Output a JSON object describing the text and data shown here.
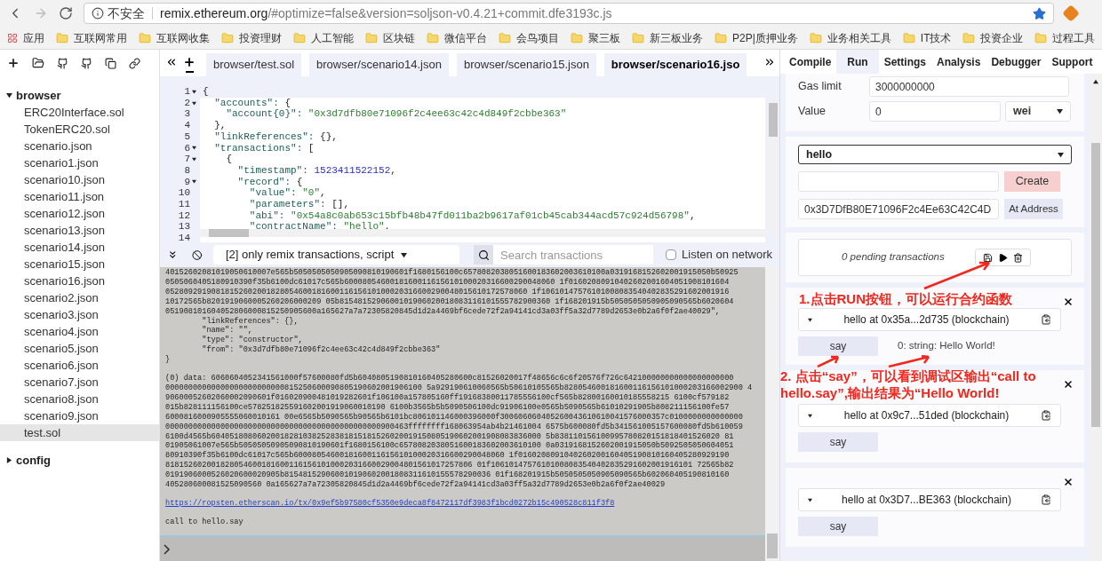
{
  "browser": {
    "security": "不安全",
    "url_host": "remix.ethereum.org",
    "url_rest": "/#optimize=false&version=soljson-v0.4.21+commit.dfe3193c.js"
  },
  "bookmarks": [
    {
      "label": "应用",
      "kind": "apps"
    },
    {
      "label": "互联网常用",
      "kind": "folder"
    },
    {
      "label": "互联网收集",
      "kind": "folder"
    },
    {
      "label": "投资理财",
      "kind": "folder"
    },
    {
      "label": "人工智能",
      "kind": "folder"
    },
    {
      "label": "区块链",
      "kind": "folder"
    },
    {
      "label": "微信平台",
      "kind": "folder"
    },
    {
      "label": "会鸟项目",
      "kind": "folder"
    },
    {
      "label": "聚三板",
      "kind": "folder"
    },
    {
      "label": "新三板业务",
      "kind": "folder"
    },
    {
      "label": "P2P|质押业务",
      "kind": "folder"
    },
    {
      "label": "业务相关工具",
      "kind": "folder"
    },
    {
      "label": "IT技术",
      "kind": "folder"
    },
    {
      "label": "投资企业",
      "kind": "folder"
    },
    {
      "label": "过程工具",
      "kind": "folder"
    }
  ],
  "file_explorer": {
    "folders": [
      {
        "name": "browser",
        "expanded": true,
        "children": [
          {
            "name": "ERC20Interface.sol",
            "selected": false
          },
          {
            "name": "TokenERC20.sol",
            "selected": false
          },
          {
            "name": "scenario.json",
            "selected": false
          },
          {
            "name": "scenario1.json",
            "selected": false
          },
          {
            "name": "scenario10.json",
            "selected": false
          },
          {
            "name": "scenario11.json",
            "selected": false
          },
          {
            "name": "scenario12.json",
            "selected": false
          },
          {
            "name": "scenario13.json",
            "selected": false
          },
          {
            "name": "scenario14.json",
            "selected": false
          },
          {
            "name": "scenario15.json",
            "selected": false
          },
          {
            "name": "scenario16.json",
            "selected": false
          },
          {
            "name": "scenario2.json",
            "selected": false
          },
          {
            "name": "scenario3.json",
            "selected": false
          },
          {
            "name": "scenario4.json",
            "selected": false
          },
          {
            "name": "scenario5.json",
            "selected": false
          },
          {
            "name": "scenario6.json",
            "selected": false
          },
          {
            "name": "scenario7.json",
            "selected": false
          },
          {
            "name": "scenario8.json",
            "selected": false
          },
          {
            "name": "scenario9.json",
            "selected": false
          },
          {
            "name": "test.sol",
            "selected": true
          }
        ]
      },
      {
        "name": "config",
        "expanded": false
      }
    ]
  },
  "editor": {
    "tabs": [
      {
        "label": "browser/test.sol",
        "selected": false
      },
      {
        "label": "browser/scenario14.json",
        "selected": false
      },
      {
        "label": "browser/scenario15.json",
        "selected": false
      },
      {
        "label": "browser/scenario16.jso",
        "selected": true
      }
    ],
    "lines": [
      {
        "number": "1",
        "fold": true,
        "text": "{"
      },
      {
        "number": "2",
        "fold": true,
        "text": "  \"accounts\": {"
      },
      {
        "number": "3",
        "fold": false,
        "text": "    \"account{0}\": \"0x3d7dfb80e71096f2c4ee63c42c4d849f2cbbe363\""
      },
      {
        "number": "4",
        "fold": false,
        "text": "  },"
      },
      {
        "number": "5",
        "fold": false,
        "text": "  \"linkReferences\": {},"
      },
      {
        "number": "6",
        "fold": true,
        "text": "  \"transactions\": ["
      },
      {
        "number": "7",
        "fold": true,
        "text": "    {"
      },
      {
        "number": "8",
        "fold": false,
        "text": "      \"timestamp\": 1523411522152,"
      },
      {
        "number": "9",
        "fold": true,
        "text": "      \"record\": {"
      },
      {
        "number": "10",
        "fold": false,
        "text": "        \"value\": \"0\","
      },
      {
        "number": "11",
        "fold": false,
        "text": "        \"parameters\": [],"
      },
      {
        "number": "12",
        "fold": false,
        "text": "        \"abi\": \"0x54a8c0ab653c15bfb48b47fd011ba2b9617af01cb45cab344acd57c924d56798\","
      },
      {
        "number": "13",
        "fold": false,
        "text": "        \"contractName\": \"hello\","
      },
      {
        "number": "14",
        "fold": false
      }
    ]
  },
  "terminal": {
    "filter": "[2] only remix transactions, script",
    "search_placeholder": "Search transactions",
    "listen_label": "Listen on network",
    "listen_checked": false,
    "blocks": [
      {
        "kind": "log",
        "lines": [
          "40152602081019050610007e565b5050505050905090810190601f1680156100c6578082038051600183602003610100a0319168152602001915050b50925",
          "0505060405180910390f35b6100dc61017c565b6000805460018160011615610100020316600290048060 1f01602080910402602001604051908101604",
          "0528092919081815260200182805460018160011615610100020316600290048015610172578060 1f10610147576101008083540402835291602001916",
          "10172565b8201919060005260206000209 05b8154815290600101906020018083116101555782900360 1f168201915b5050505050905090565b6020604",
          "051908101604052806000815250905600a165627a7a72305820845d1d2a4469bf6cede72f2a94141cd3a03ff5a32d7789d2653e0b2a6f0f2ae40029\",",
          "        \"linkReferences\": {},",
          "        \"name\": \"\",",
          "        \"type\": \"constructor\",",
          "        \"from\": \"0x3d7dfb80e71096f2c4ee63c42c4d849f2cbbe363\"",
          "}"
        ]
      },
      {
        "kind": "log",
        "lines": [
          "(0) data: 6060604052341561000f57600080fd5b6040805190810160405280600c81526020017f48656c6c6f20576f726c642100000000000000000000",
          "00000000000000000000000000815250600090805190602001906100 5a929190610060565b50610105565b828054600181600116156101000203166002900 4",
          "90600052602060002090601f016020900481019282601f106100a157805160ff19168380011785556100cf565b82800160010185558215 6100cf579182",
          "015b828111156100ce578251825591602001919060010190 6100b3565b5b5090506100dc91906100e0565b5090565b61010291905b808211156100fe57",
          "6000816000905555060010161 00e6565b5090565b90565b6101bc806101146000396000f300606060405260043610610041576000357c0100000000000000",
          "00000000000000000000000000000000000000000000000900463ffffffff168063954ab4b21461004 6575b600080fd5b341561005157600080fd5b610059",
          "6100d4565b604051808060200182810382528381815181526020019150805190602001908083836000 5b838110156100995780820151818401526020 81",
          "01905061007e565b50505050905090810190601f1680156100c6578082038051600183602003610100 0a0319168152602001915050b5092505050604051",
          "80910390f35b6100dc61017c565b6000805460018160011615610100020316600290048060 1f0160208091040260200160405190810160405280929190",
          "8181526020018280546001816001161561010002031660029004801561017257806 01f10610147576101008083540402835291602001916101 72565b82",
          "0191906000526020600020905b815481529060010190602001808311610155578290036 01f168201915b5050505050905090565b602060405190810160",
          "405280600081525090560 0a165627a7a72305820845d1d2a4469bf6cede72f2a94141cd3a03ff5a32d7789d2653e0b2a6f0f2ae40029"
        ]
      },
      {
        "kind": "link",
        "lines": [
          "https://ropsten.etherscan.io/tx/0x9ef5b97580cf5350e9deca8f8472117df3983f1bcd0272b15c490528c811f3f8"
        ]
      },
      {
        "kind": "log",
        "lines": [
          "call to hello.say"
        ]
      }
    ]
  },
  "run_panel": {
    "tabs": [
      {
        "label": "Compile",
        "selected": false
      },
      {
        "label": "Run",
        "selected": true
      },
      {
        "label": "Settings",
        "selected": false
      },
      {
        "label": "Analysis",
        "selected": false
      },
      {
        "label": "Debugger",
        "selected": false
      },
      {
        "label": "Support",
        "selected": false
      }
    ],
    "gas_limit_label": "Gas limit",
    "gas_limit": "3000000000",
    "value_label": "Value",
    "value": "0",
    "unit": "wei",
    "contract": "hello",
    "create_button": "Create",
    "address": "0x3D7DfB80E71096F2c4Ee63C42C4D",
    "at_address_button": "At Address",
    "pending": "0 pending transactions",
    "instances": [
      {
        "title": "hello at 0x35a...2d735 (blockchain)",
        "function": "say",
        "output": "0: string: Hello World!"
      },
      {
        "title": "hello at 0x9c7...51ded (blockchain)",
        "function": "say"
      },
      {
        "title": "hello at 0x3D7...BE363 (blockchain)",
        "function": "say"
      }
    ]
  },
  "annotations": [
    {
      "text": "1.点击RUN按钮，可以运行合约函数"
    },
    {
      "text": "2. 点击“say”，可以看到调试区输出“call to hello.say”,输出结果为“Hello World!"
    }
  ]
}
